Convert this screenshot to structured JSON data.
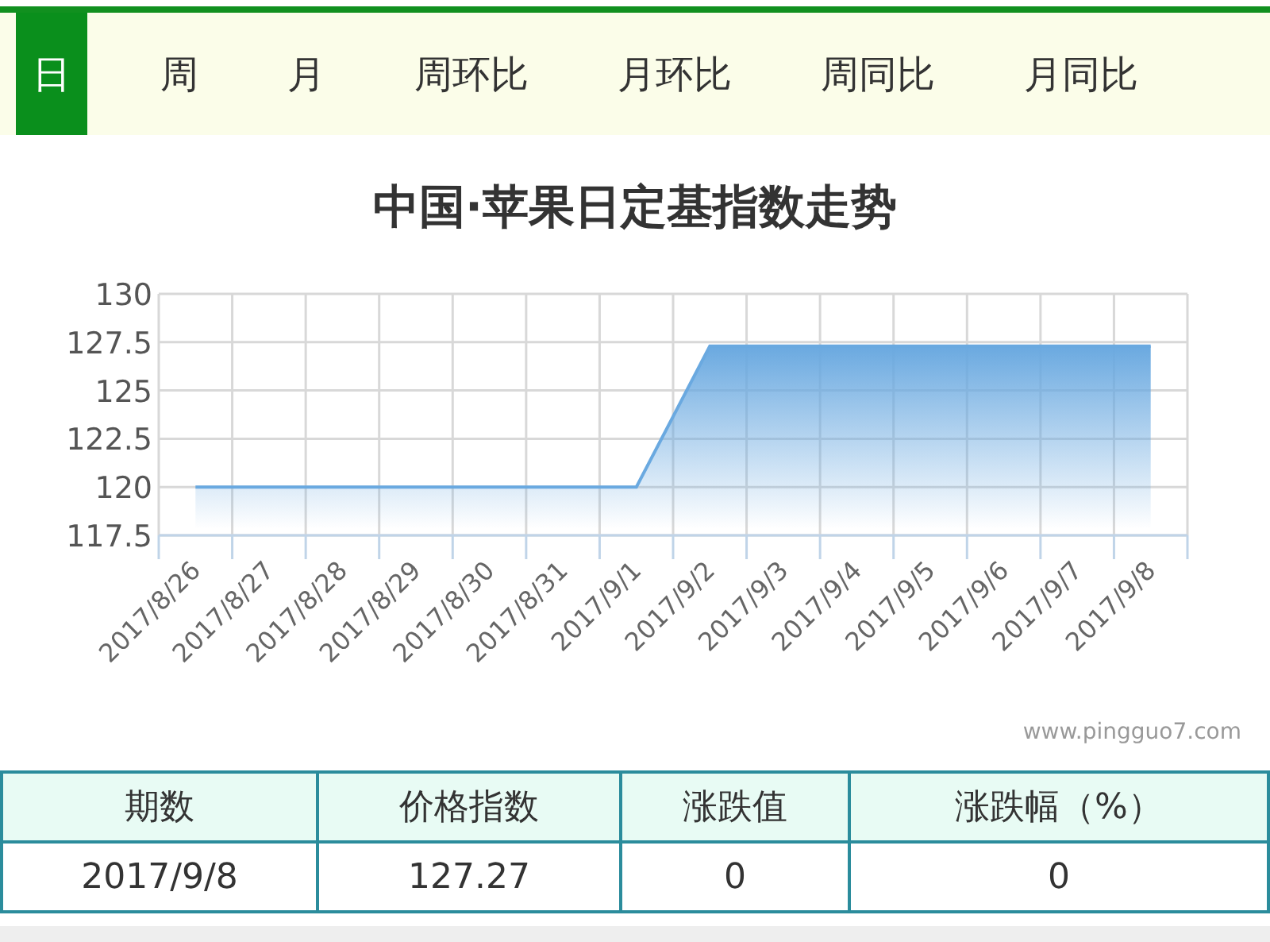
{
  "tabs": [
    {
      "label": "日",
      "selected": true
    },
    {
      "label": "周",
      "selected": false
    },
    {
      "label": "月",
      "selected": false
    },
    {
      "label": "周环比",
      "selected": false
    },
    {
      "label": "月环比",
      "selected": false
    },
    {
      "label": "周同比",
      "selected": false
    },
    {
      "label": "月同比",
      "selected": false
    }
  ],
  "chart": {
    "credit": "www.pingguo7.com",
    "chart_data": {
      "type": "area",
      "title": "中国·苹果日定基指数走势",
      "categories": [
        "2017/8/26",
        "2017/8/27",
        "2017/8/28",
        "2017/8/29",
        "2017/8/30",
        "2017/8/31",
        "2017/9/1",
        "2017/9/2",
        "2017/9/3",
        "2017/9/4",
        "2017/9/5",
        "2017/9/6",
        "2017/9/7",
        "2017/9/8"
      ],
      "series": [
        {
          "color": "#6aa9e0",
          "values": [
            120,
            120,
            120,
            120,
            120,
            120,
            120,
            127.3,
            127.3,
            127.3,
            127.3,
            127.3,
            127.3,
            127.3
          ]
        }
      ],
      "grid": true,
      "ylim": [
        117.5,
        130
      ],
      "yticks": [
        117.5,
        120,
        122.5,
        125,
        127.5,
        130
      ]
    }
  },
  "table": {
    "columns": [
      "期数",
      "价格指数",
      "涨跌值",
      "涨跌幅（%）"
    ],
    "rows": [
      [
        "2017/9/8",
        "127.27",
        "0",
        "0"
      ]
    ]
  }
}
